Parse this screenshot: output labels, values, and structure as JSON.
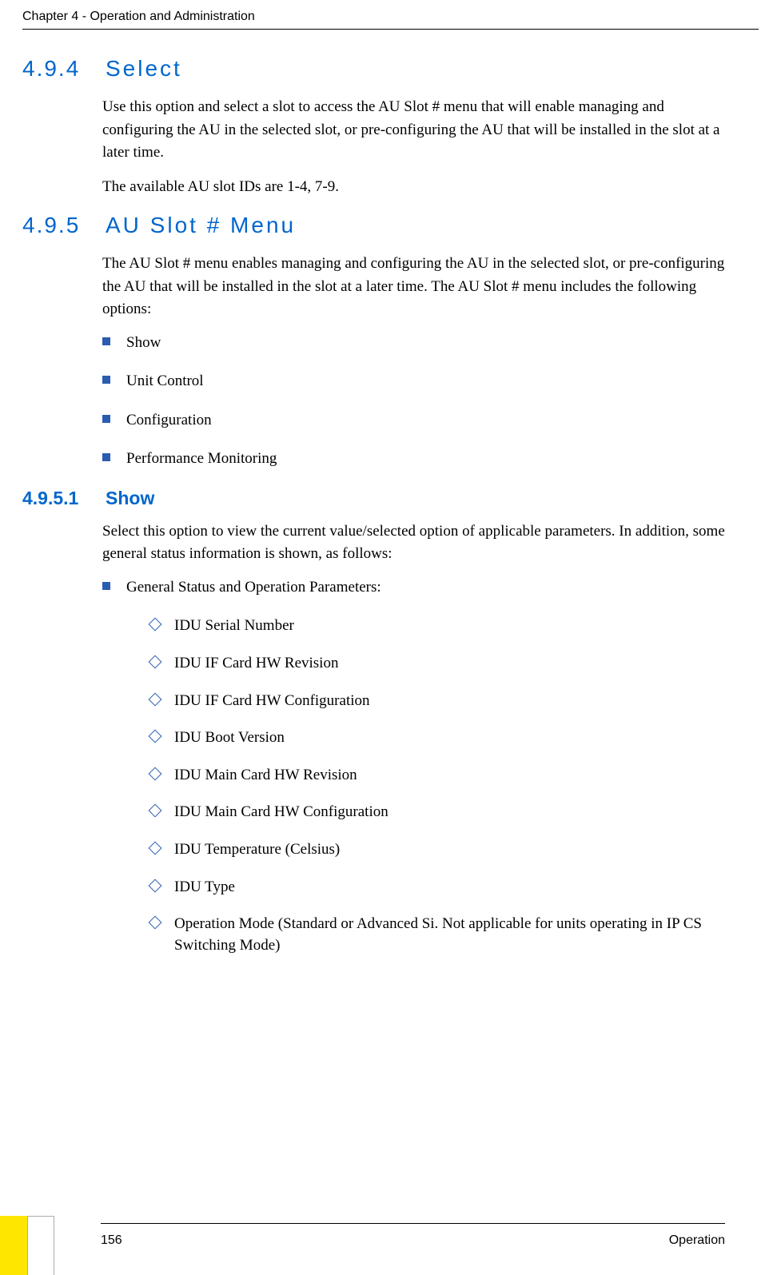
{
  "header": {
    "text": "Chapter 4 - Operation and Administration"
  },
  "sections": {
    "s494": {
      "num": "4.9.4",
      "title": "Select",
      "p1": "Use this option and select a slot to access the AU Slot # menu that will enable managing and configuring the AU in the selected slot, or pre-configuring the AU that will be installed in the slot at a later time.",
      "p2": "The available AU slot IDs are 1-4, 7-9."
    },
    "s495": {
      "num": "4.9.5",
      "title": "AU Slot # Menu",
      "p1": "The AU Slot # menu enables managing and configuring the AU in the selected slot, or pre-configuring the AU that will be installed in the slot at a later time. The AU Slot # menu includes the following options:",
      "items": [
        "Show",
        "Unit Control",
        "Configuration",
        "Performance Monitoring"
      ]
    },
    "s4951": {
      "num": "4.9.5.1",
      "title": "Show",
      "p1": "Select this option to view the current value/selected option of applicable parameters. In addition, some general status information is shown, as follows:",
      "top": "General Status and Operation Parameters:",
      "sub": [
        "IDU Serial Number",
        "IDU IF Card HW Revision",
        "IDU IF Card HW Configuration",
        "IDU Boot Version",
        "IDU Main Card HW Revision",
        "IDU Main Card HW Configuration",
        "IDU Temperature (Celsius)",
        "IDU Type",
        "Operation Mode (Standard or Advanced Si. Not applicable for units operating in IP CS Switching Mode)"
      ]
    }
  },
  "footer": {
    "page": "156",
    "label": "Operation"
  }
}
